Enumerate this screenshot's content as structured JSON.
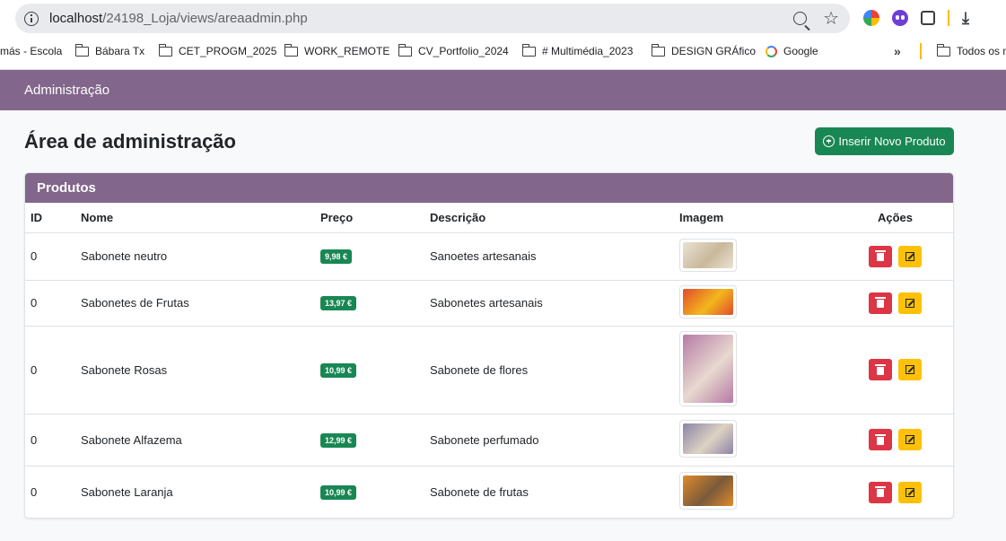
{
  "browser": {
    "url_host": "localhost",
    "url_path": "/24198_Loja/views/areaadmin.php",
    "bookmarks": [
      {
        "label": "más - Escola",
        "icon": "none"
      },
      {
        "label": "Bábara Tx",
        "icon": "folder-icon"
      },
      {
        "label": "CET_PROGM_2025",
        "icon": "folder-icon"
      },
      {
        "label": "WORK_REMOTE",
        "icon": "folder-icon"
      },
      {
        "label": "CV_Portfolio_2024",
        "icon": "folder-icon"
      },
      {
        "label": "# Multimédia_2023",
        "icon": "folder-icon"
      },
      {
        "label": "DESIGN GRÁfico",
        "icon": "folder-icon"
      },
      {
        "label": "Google",
        "icon": "google-icon"
      },
      {
        "label": "Todos os m",
        "icon": "folder-icon"
      }
    ],
    "overflow_label": "»"
  },
  "navbar": {
    "brand": "Administração"
  },
  "page": {
    "title": "Área de administração",
    "insert_button": "Inserir Novo Produto"
  },
  "products": {
    "header": "Produtos",
    "columns": {
      "id": "ID",
      "name": "Nome",
      "price": "Preço",
      "description": "Descrição",
      "image": "Imagem",
      "actions": "Ações"
    },
    "rows": [
      {
        "id": "0",
        "name": "Sabonete neutro",
        "price": "9,98 €",
        "description": "Sanoetes artesanais",
        "thumb_colors": [
          "#e9e2d4",
          "#c9b89a"
        ]
      },
      {
        "id": "0",
        "name": "Sabonetes de Frutas",
        "price": "13,97 €",
        "description": "Sabonetes artesanais",
        "thumb_colors": [
          "#e24b2c",
          "#f2b81c"
        ]
      },
      {
        "id": "0",
        "name": "Sabonete Rosas",
        "price": "10,99 €",
        "description": "Sabonete de flores",
        "thumb_colors": [
          "#b67aa6",
          "#e8d9cf"
        ]
      },
      {
        "id": "0",
        "name": "Sabonete Alfazema",
        "price": "12,99 €",
        "description": "Sabonete perfumado",
        "thumb_colors": [
          "#8c84a8",
          "#ddd3c2"
        ]
      },
      {
        "id": "0",
        "name": "Sabonete Laranja",
        "price": "10,99 €",
        "description": "Sabonete de frutas",
        "thumb_colors": [
          "#e08a2a",
          "#7a5a3a"
        ]
      }
    ]
  },
  "colors": {
    "brand": "#82668b",
    "success": "#198754",
    "danger": "#dc3545",
    "warning": "#ffc107"
  }
}
